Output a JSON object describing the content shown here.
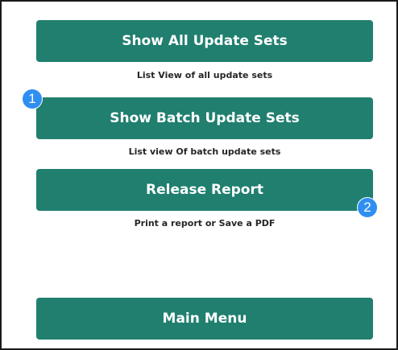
{
  "buttons": {
    "show_all": {
      "label": "Show All Update Sets",
      "caption": "List View of all update sets"
    },
    "show_batch": {
      "label": "Show Batch Update Sets",
      "caption": "List view Of batch update sets"
    },
    "release_report": {
      "label": "Release Report",
      "caption": "Print a report or Save a PDF"
    },
    "main_menu": {
      "label": "Main Menu"
    }
  },
  "badges": {
    "first": "1",
    "second": "2"
  },
  "colors": {
    "button_bg": "#207f6f",
    "badge_bg": "#2f8ff1"
  }
}
